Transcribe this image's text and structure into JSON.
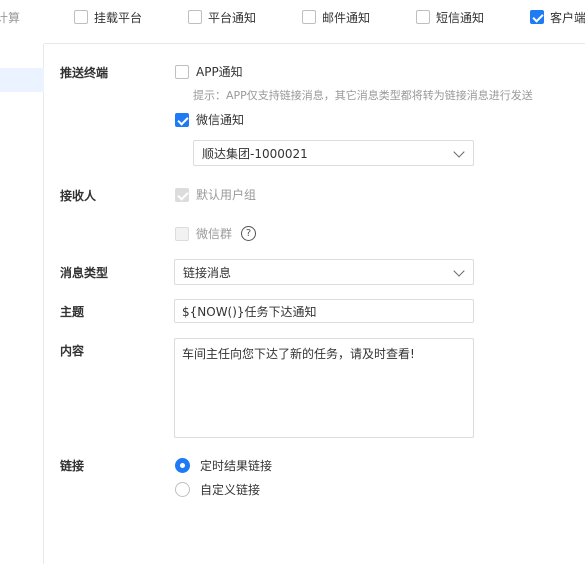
{
  "top_bar": {
    "prefix_text": "计算",
    "items": [
      {
        "label": "挂载平台",
        "checked": false
      },
      {
        "label": "平台通知",
        "checked": false
      },
      {
        "label": "邮件通知",
        "checked": false
      },
      {
        "label": "短信通知",
        "checked": false
      },
      {
        "label": "客户端",
        "checked": true
      }
    ]
  },
  "form": {
    "push_terminal": {
      "label": "推送终端",
      "app_option": {
        "label": "APP通知",
        "checked": false
      },
      "hint": "提示：APP仅支持链接消息，其它消息类型都将转为链接消息进行发送",
      "wechat_option": {
        "label": "微信通知",
        "checked": true
      },
      "wechat_account_select": "顺达集团-1000021"
    },
    "recipients": {
      "label": "接收人",
      "default_group": {
        "label": "默认用户组",
        "checked": true,
        "disabled": true
      },
      "wechat_group": {
        "label": "微信群",
        "checked": false,
        "disabled": true
      },
      "help_icon_glyph": "?"
    },
    "message_type": {
      "label": "消息类型",
      "value": "链接消息"
    },
    "subject": {
      "label": "主题",
      "value": "${NOW()}任务下达通知"
    },
    "content": {
      "label": "内容",
      "value": "车间主任向您下达了新的任务，请及时查看!"
    },
    "link": {
      "label": "链接",
      "options": [
        {
          "label": "定时结果链接",
          "selected": true
        },
        {
          "label": "自定义链接",
          "selected": false
        }
      ]
    }
  },
  "colors": {
    "accent": "#1e7bf5",
    "border": "#dcdcdc",
    "muted_text": "#999999"
  }
}
